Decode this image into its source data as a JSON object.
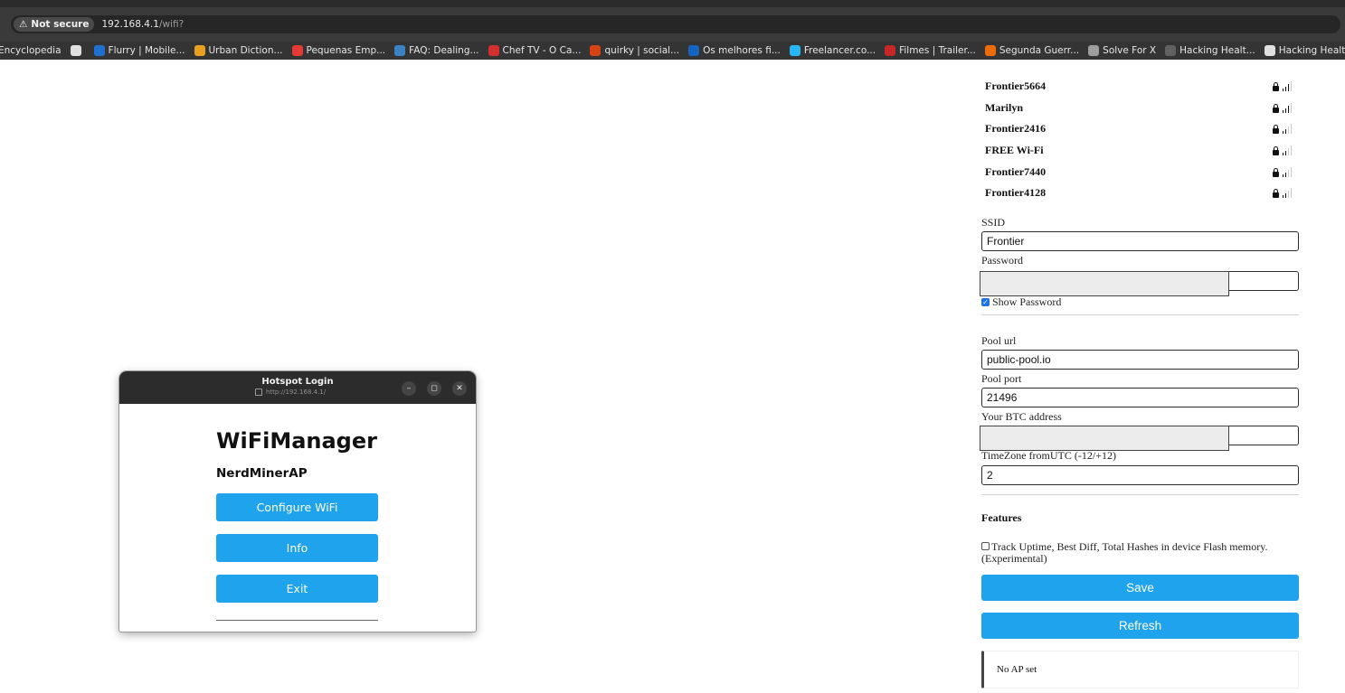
{
  "browser": {
    "security_label": "Not secure",
    "url_host": "192.168.4.1",
    "url_path": "/wifi?",
    "bookmarks": [
      {
        "label": "Encyclopedia",
        "color": "#343434"
      },
      {
        "label": "",
        "color": "#e0e0e0"
      },
      {
        "label": "Flurry | Mobile...",
        "color": "#1f6fd1"
      },
      {
        "label": "Urban Diction...",
        "color": "#e8a020"
      },
      {
        "label": "Pequenas Emp...",
        "color": "#e53935"
      },
      {
        "label": "FAQ: Dealing...",
        "color": "#3b82c4"
      },
      {
        "label": "Chef TV - O Ca...",
        "color": "#d32f2f"
      },
      {
        "label": "quirky | social...",
        "color": "#d84315"
      },
      {
        "label": "Os melhores fi...",
        "color": "#1565c0"
      },
      {
        "label": "Freelancer.co...",
        "color": "#29b6f6"
      },
      {
        "label": "Filmes | Trailer...",
        "color": "#c62828"
      },
      {
        "label": "Segunda Guerr...",
        "color": "#ef6c00"
      },
      {
        "label": "Solve For X",
        "color": "#9e9e9e"
      },
      {
        "label": "Hacking Healt...",
        "color": "#616161"
      },
      {
        "label": "Hacking Healt...",
        "color": "#e0e0e0"
      }
    ]
  },
  "networks": [
    {
      "ssid": "Frontier5664",
      "signal": 3
    },
    {
      "ssid": "Marilyn",
      "signal": 3
    },
    {
      "ssid": "Frontier2416",
      "signal": 2
    },
    {
      "ssid": "FREE Wi-Fi",
      "signal": 2
    },
    {
      "ssid": "Frontier7440",
      "signal": 2
    },
    {
      "ssid": "Frontier4128",
      "signal": 2
    }
  ],
  "form": {
    "ssid_label": "SSID",
    "ssid_value": "Frontier",
    "password_label": "Password",
    "show_password_label": "Show Password",
    "pool_url_label": "Pool url",
    "pool_url_value": "public-pool.io",
    "pool_port_label": "Pool port",
    "pool_port_value": "21496",
    "btc_label": "Your BTC address",
    "tz_label": "TimeZone fromUTC (-12/+12)",
    "tz_value": "2",
    "features_title": "Features",
    "feature_label": "Track Uptime, Best Diff, Total Hashes in device Flash memory. (Experimental)",
    "save_label": "Save",
    "refresh_label": "Refresh",
    "status_msg": "No AP set"
  },
  "popup": {
    "title": "Hotspot Login",
    "url": "http://192.168.4.1/",
    "heading": "WiFiManager",
    "subheading": "NerdMinerAP",
    "btn_configure": "Configure WiFi",
    "btn_info": "Info",
    "btn_exit": "Exit"
  },
  "colors": {
    "accent": "#1fa3ec",
    "chrome_dark": "#3a3a3a"
  }
}
